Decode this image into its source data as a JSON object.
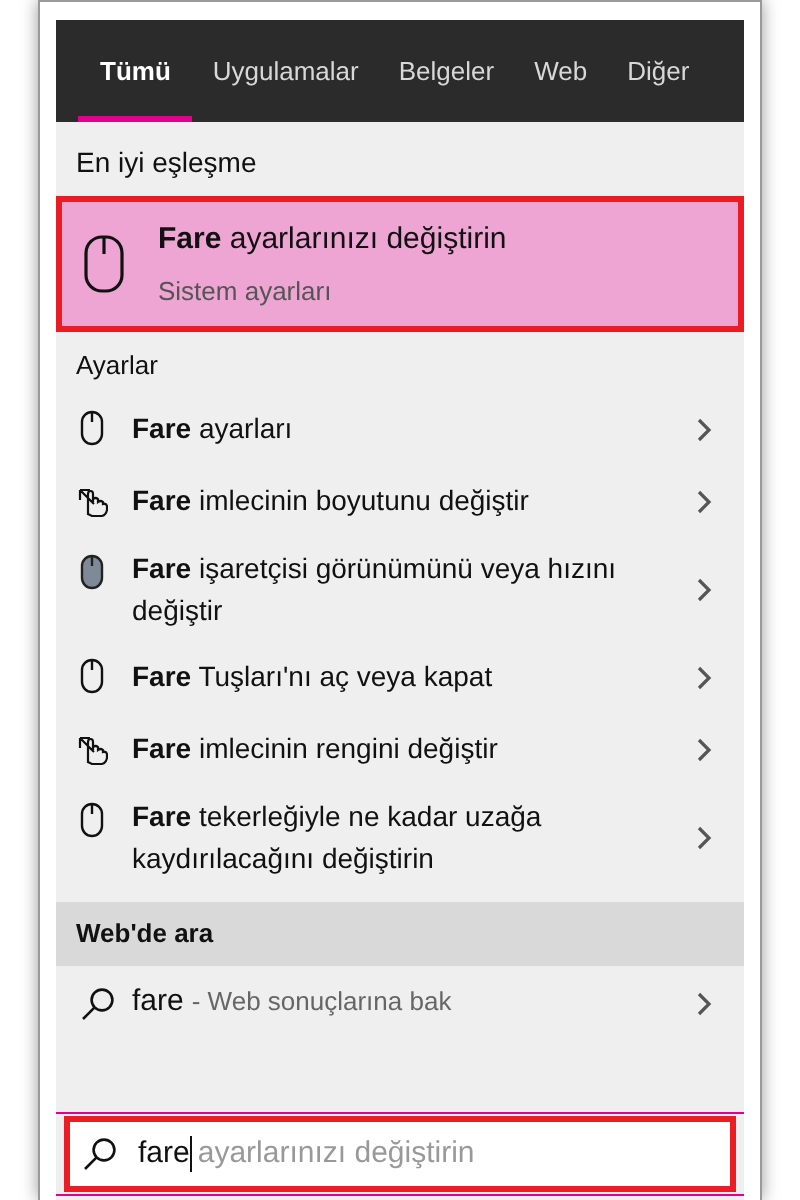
{
  "tabs": [
    {
      "label": "Tümü",
      "selected": true
    },
    {
      "label": "Uygulamalar",
      "selected": false
    },
    {
      "label": "Belgeler",
      "selected": false
    },
    {
      "label": "Web",
      "selected": false
    },
    {
      "label": "Diğer",
      "selected": false
    }
  ],
  "best_match": {
    "header": "En iyi eşleşme",
    "title": "**Fare** ayarlarınızı değiştirin",
    "subtitle": "Sistem ayarları",
    "highlighted": true
  },
  "settings": {
    "header": "Ayarlar",
    "items": [
      {
        "kind": "mouse",
        "label": "**Fare** ayarları"
      },
      {
        "kind": "pointer",
        "label": "**Fare** imlecinin boyutunu değiştir"
      },
      {
        "kind": "mouse-filled",
        "label": "**Fare** işaretçisi görünümünü veya hızını değiştir"
      },
      {
        "kind": "mouse",
        "label": "**Fare** Tuşları'nı aç veya kapat"
      },
      {
        "kind": "pointer",
        "label": "**Fare** imlecinin rengini değiştir"
      },
      {
        "kind": "mouse",
        "label": "**Fare** tekerleğiyle ne kadar uzağa kaydırılacağını değiştirin"
      }
    ]
  },
  "web": {
    "header": "Web'de ara",
    "query": "fare",
    "hint": "- Web sonuçlarına bak"
  },
  "search": {
    "value": "fare",
    "suggestion": "ayarlarınızı değiştirin",
    "highlighted": true
  }
}
